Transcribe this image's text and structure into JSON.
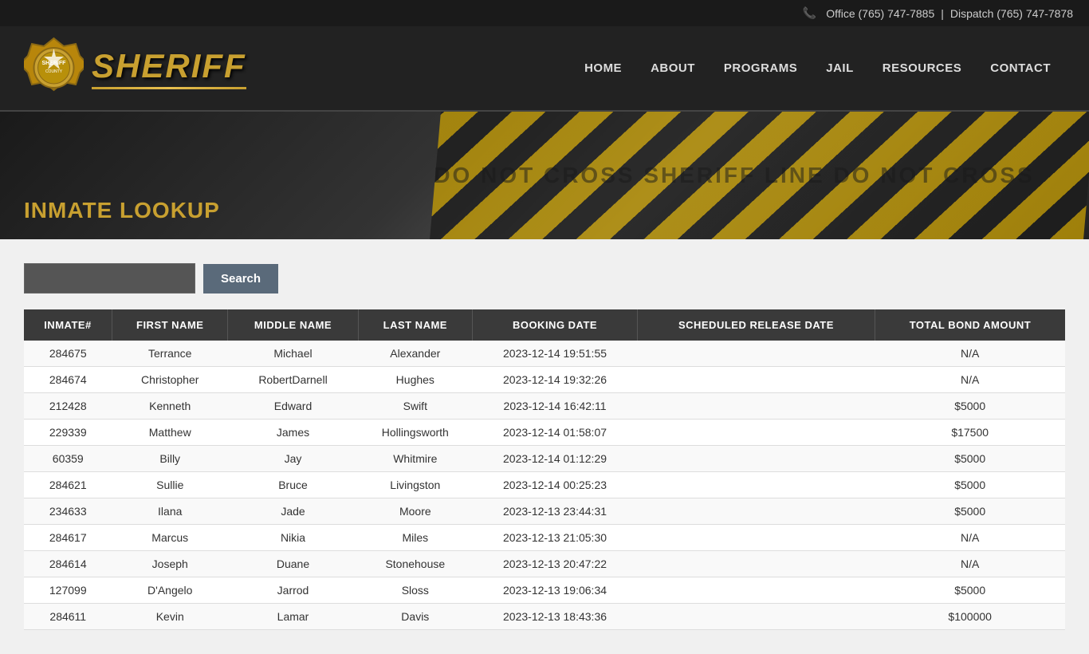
{
  "topbar": {
    "phone_icon": "📞",
    "office_label": "Office (765) 747-7885",
    "separator": "|",
    "dispatch_label": "Dispatch (765) 747-7878"
  },
  "header": {
    "logo_text": "SHERIFF",
    "nav_items": [
      {
        "label": "HOME",
        "id": "home"
      },
      {
        "label": "ABOUT",
        "id": "about"
      },
      {
        "label": "PROGRAMS",
        "id": "programs"
      },
      {
        "label": "JAIL",
        "id": "jail"
      },
      {
        "label": "RESOURCES",
        "id": "resources"
      },
      {
        "label": "CONTACT",
        "id": "contact"
      }
    ]
  },
  "hero": {
    "tape_text": "DO NOT CROSS  SHERIFF LINE  DO NOT CROSS",
    "page_title": "INMATE LOOKUP"
  },
  "search": {
    "input_placeholder": "",
    "button_label": "Search"
  },
  "table": {
    "columns": [
      "INMATE#",
      "FIRST NAME",
      "MIDDLE NAME",
      "LAST NAME",
      "BOOKING DATE",
      "SCHEDULED RELEASE DATE",
      "TOTAL BOND AMOUNT"
    ],
    "rows": [
      {
        "inmate_num": "284675",
        "first": "Terrance",
        "middle": "Michael",
        "last": "Alexander",
        "booking": "2023-12-14 19:51:55",
        "release": "",
        "bond": "N/A"
      },
      {
        "inmate_num": "284674",
        "first": "Christopher",
        "middle": "RobertDarnell",
        "last": "Hughes",
        "booking": "2023-12-14 19:32:26",
        "release": "",
        "bond": "N/A"
      },
      {
        "inmate_num": "212428",
        "first": "Kenneth",
        "middle": "Edward",
        "last": "Swift",
        "booking": "2023-12-14 16:42:11",
        "release": "",
        "bond": "$5000"
      },
      {
        "inmate_num": "229339",
        "first": "Matthew",
        "middle": "James",
        "last": "Hollingsworth",
        "booking": "2023-12-14 01:58:07",
        "release": "",
        "bond": "$17500"
      },
      {
        "inmate_num": "60359",
        "first": "Billy",
        "middle": "Jay",
        "last": "Whitmire",
        "booking": "2023-12-14 01:12:29",
        "release": "",
        "bond": "$5000"
      },
      {
        "inmate_num": "284621",
        "first": "Sullie",
        "middle": "Bruce",
        "last": "Livingston",
        "booking": "2023-12-14 00:25:23",
        "release": "",
        "bond": "$5000"
      },
      {
        "inmate_num": "234633",
        "first": "Ilana",
        "middle": "Jade",
        "last": "Moore",
        "booking": "2023-12-13 23:44:31",
        "release": "",
        "bond": "$5000"
      },
      {
        "inmate_num": "284617",
        "first": "Marcus",
        "middle": "Nikia",
        "last": "Miles",
        "booking": "2023-12-13 21:05:30",
        "release": "",
        "bond": "N/A"
      },
      {
        "inmate_num": "284614",
        "first": "Joseph",
        "middle": "Duane",
        "last": "Stonehouse",
        "booking": "2023-12-13 20:47:22",
        "release": "",
        "bond": "N/A"
      },
      {
        "inmate_num": "127099",
        "first": "D'Angelo",
        "middle": "Jarrod",
        "last": "Sloss",
        "booking": "2023-12-13 19:06:34",
        "release": "",
        "bond": "$5000"
      },
      {
        "inmate_num": "284611",
        "first": "Kevin",
        "middle": "Lamar",
        "last": "Davis",
        "booking": "2023-12-13 18:43:36",
        "release": "",
        "bond": "$100000"
      }
    ]
  }
}
